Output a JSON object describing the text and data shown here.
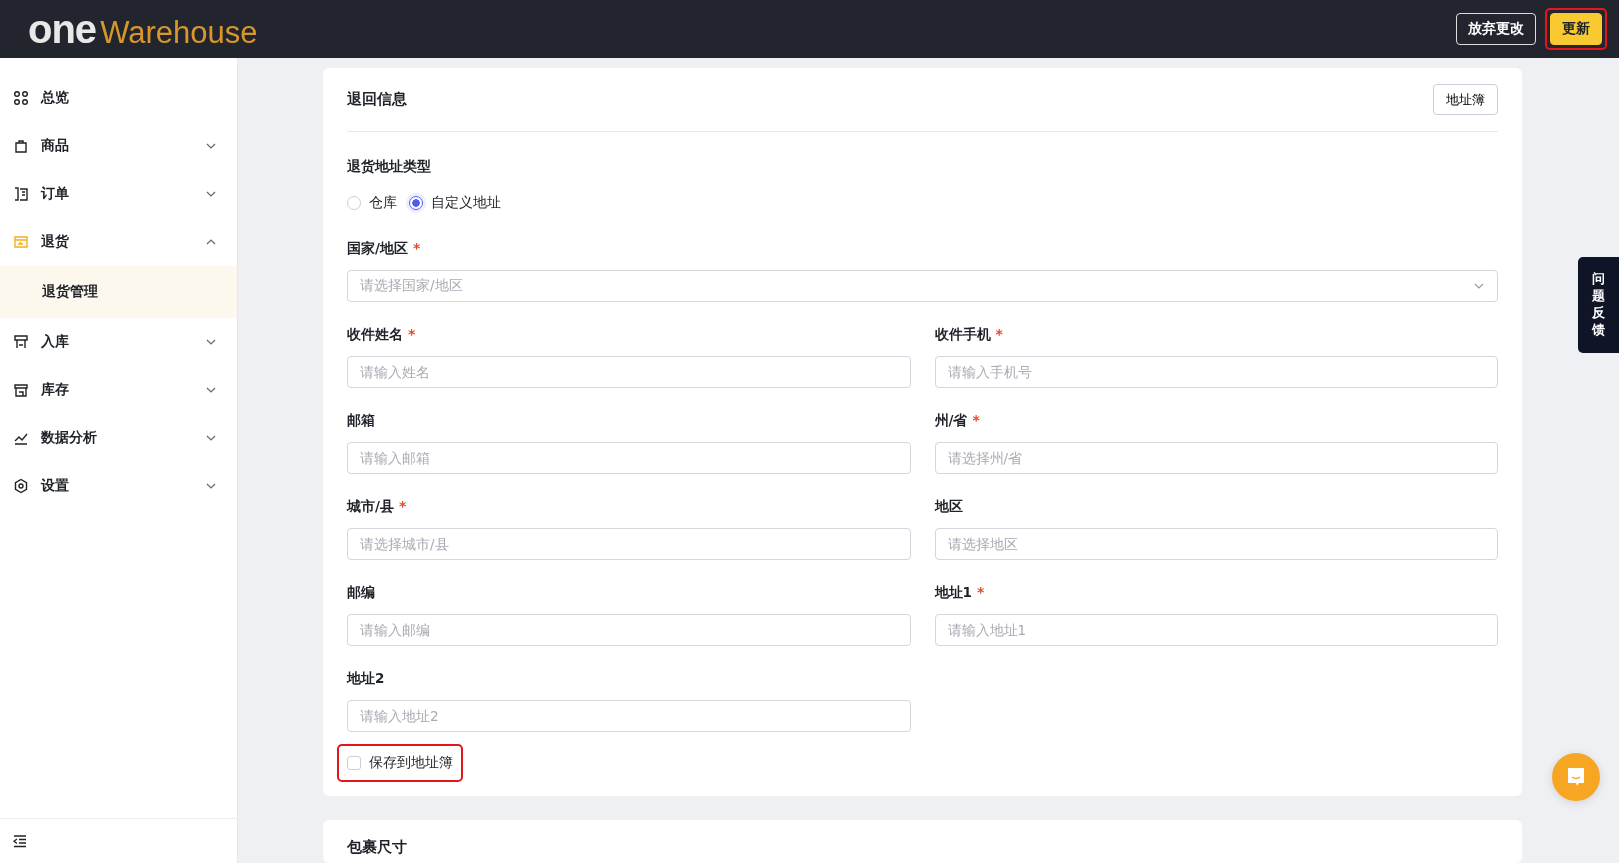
{
  "header": {
    "logo_one": "one",
    "logo_rest": "Warehouse",
    "buttons": [
      {
        "label": "放弃更改",
        "kind": "outline",
        "highlighted": false
      },
      {
        "label": "更新",
        "kind": "primary",
        "highlighted": true
      }
    ]
  },
  "sidebar": {
    "items": [
      {
        "label": "总览",
        "active": false
      },
      {
        "label": "商品",
        "expanded": false,
        "active": false
      },
      {
        "label": "订单",
        "expanded": false,
        "active": false
      },
      {
        "label": "退货",
        "expanded": true,
        "active": true,
        "children": [
          {
            "label": "退货管理",
            "selected": true
          }
        ]
      },
      {
        "label": "入库",
        "expanded": false,
        "active": false
      },
      {
        "label": "库存",
        "expanded": false,
        "active": false
      },
      {
        "label": "数据分析",
        "expanded": false,
        "active": false
      },
      {
        "label": "设置",
        "expanded": false,
        "active": false
      }
    ]
  },
  "return_info": {
    "title": "退回信息",
    "address_book_button": "地址簿",
    "address_type": {
      "label": "退货地址类型",
      "options": [
        {
          "label": "仓库",
          "selected": false
        },
        {
          "label": "自定义地址",
          "selected": true
        }
      ]
    },
    "fields": [
      {
        "label": "国家/地区",
        "required_mark": "*",
        "placeholder": "请选择国家/地区",
        "kind": "select"
      },
      {
        "label": "收件姓名",
        "required_mark": "*",
        "placeholder": "请输入姓名",
        "kind": "input"
      },
      {
        "label": "收件手机",
        "required_mark": "*",
        "placeholder": "请输入手机号",
        "kind": "input"
      },
      {
        "label": "邮箱",
        "placeholder": "请输入邮箱",
        "kind": "input"
      },
      {
        "label": "州/省",
        "required_mark": "*",
        "placeholder": "请选择州/省",
        "kind": "input"
      },
      {
        "label": "城市/县",
        "required_mark": "*",
        "placeholder": "请选择城市/县",
        "kind": "input"
      },
      {
        "label": "地区",
        "placeholder": "请选择地区",
        "kind": "input"
      },
      {
        "label": "邮编",
        "placeholder": "请输入邮编",
        "kind": "input"
      },
      {
        "label": "地址1",
        "required_mark": "*",
        "placeholder": "请输入地址1",
        "kind": "input"
      },
      {
        "label": "地址2",
        "placeholder": "请输入地址2",
        "kind": "input"
      }
    ],
    "save_checkbox": {
      "label": "保存到地址簿",
      "checked": false,
      "highlighted": true
    }
  },
  "package_section": {
    "title": "包裹尺寸"
  },
  "feedback_tab": "问题反馈"
}
